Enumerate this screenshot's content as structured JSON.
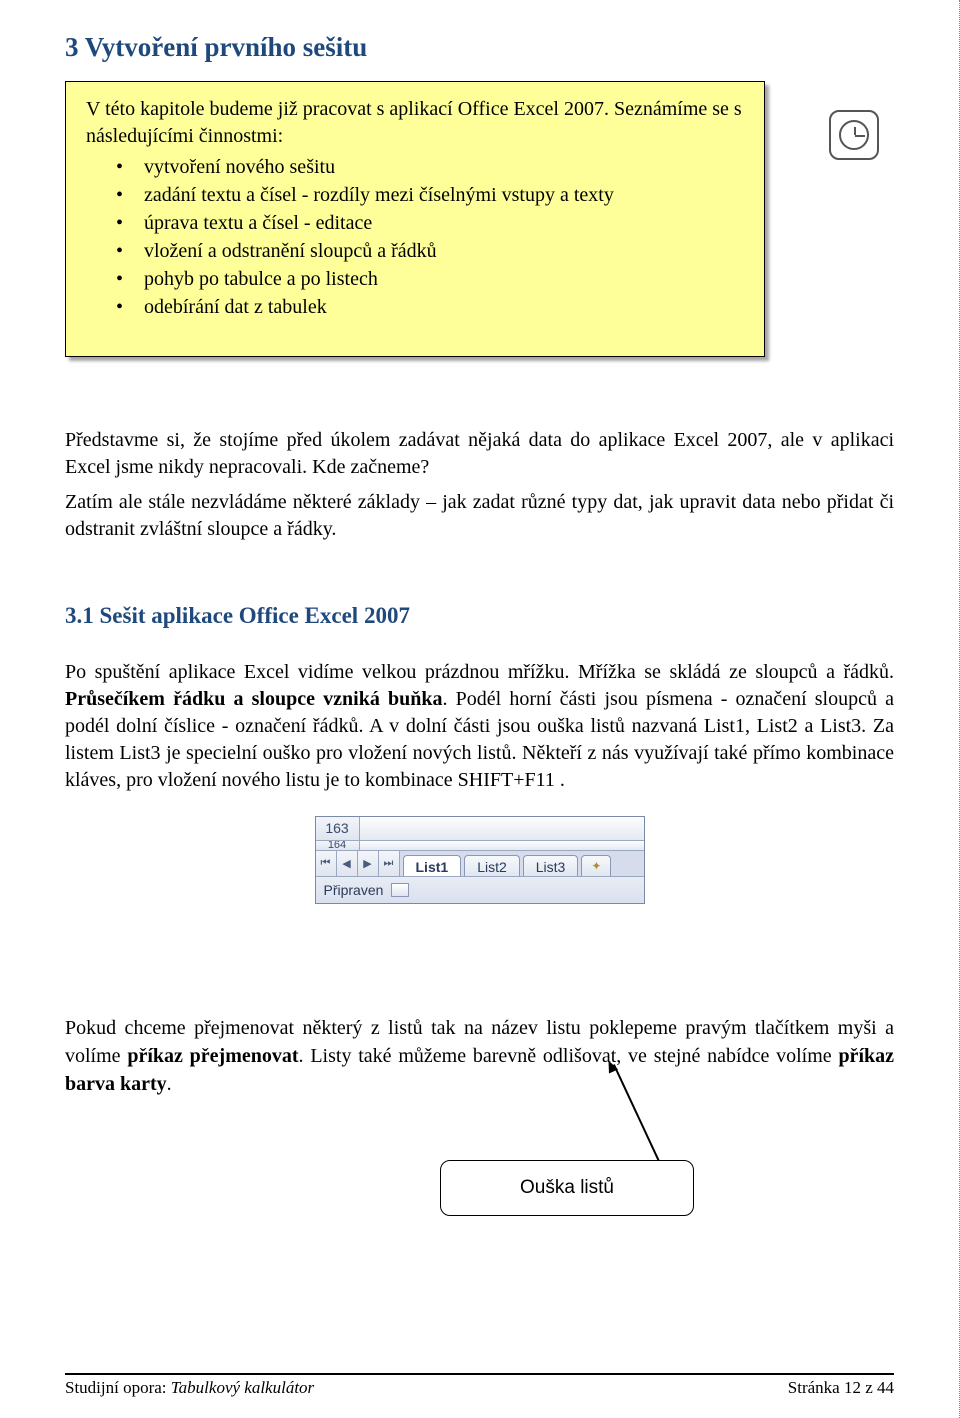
{
  "heading1": "3  Vytvoření prvního sešitu",
  "callout": {
    "lead1": "V této kapitole budeme již pracovat s aplikací Office Excel 2007. Seznámíme se s následujícími činnostmi:",
    "items": [
      "vytvoření nového sešitu",
      "zadání textu a čísel - rozdíly mezi číselnými vstupy a texty",
      "úprava textu a čísel - editace",
      "vložení a odstranění sloupců a řádků",
      "pohyb po tabulce a po listech",
      "odebírání dat z tabulek"
    ]
  },
  "para1": "Představme si, že stojíme před úkolem zadávat nějaká data do aplikace Excel 2007, ale v aplikaci Excel jsme nikdy nepracovali. Kde začneme?",
  "para2": "Zatím ale stále nezvládáme některé základy – jak zadat různé typy dat, jak upravit data nebo přidat či odstranit zvláštní sloupce a řádky.",
  "heading2": "3.1   Sešit aplikace Office Excel 2007",
  "section": {
    "t1": "Po spuštění aplikace Excel vidíme velkou prázdnou mřížku. Mřížka se skládá ze sloupců a řádků. ",
    "b1": "Průsečíkem řádku a sloupce vzniká buňka",
    "t2": ". Podél horní části jsou písmena - označení sloupců a podél dolní číslice - označení řádků. A v dolní části jsou ouška listů nazvaná List1, List2 a List3. Za listem List3 je specielní ouško pro vložení nových listů. Někteří z nás využívají také přímo kombinace kláves, pro vložení nového listu je to kombinace SHIFT+F11 ."
  },
  "excel": {
    "row_a": "163",
    "row_b": "164",
    "tabs": [
      "List1",
      "List2",
      "List3"
    ],
    "status": "Připraven"
  },
  "label": "Ouška listů",
  "after": {
    "t1": "Pokud chceme přejmenovat některý z listů tak na název listu poklepeme pravým tlačítkem myši a volíme ",
    "b1": "příkaz přejmenovat",
    "t2": ". Listy také můžeme barevně odlišovat, ve stejné nabídce volíme ",
    "b2": "příkaz barva karty",
    "t3": "."
  },
  "footer": {
    "left_prefix": "Studijní opora: ",
    "left_italic": "Tabulkový kalkulátor",
    "right": "Stránka 12 z 44"
  }
}
